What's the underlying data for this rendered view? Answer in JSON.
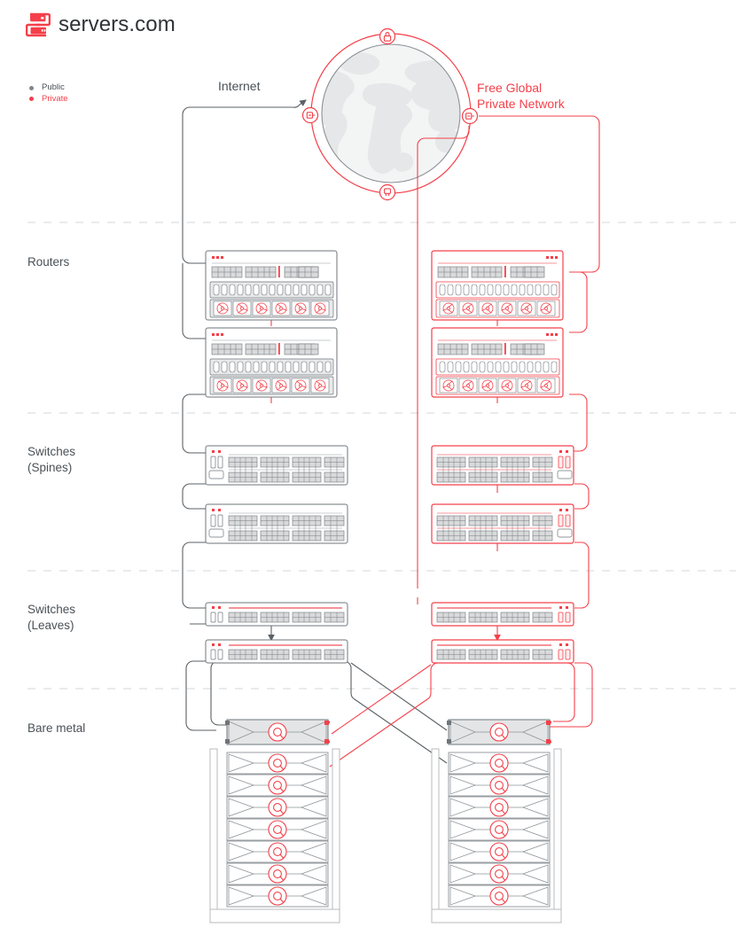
{
  "brand": {
    "name": "servers.com",
    "logo_icon": "servers-logo-icon",
    "color": "#f4404a"
  },
  "legend": {
    "items": [
      {
        "label": "Public",
        "color": "#7e868d",
        "icon": "legend-dot-icon"
      },
      {
        "label": "Private",
        "color": "#f4404a",
        "icon": "legend-dot-icon"
      }
    ]
  },
  "labels": {
    "internet": "Internet",
    "private_network": "Free Global\nPrivate Network",
    "routers": "Routers",
    "spines": "Switches\n(Spines)",
    "leaves": "Switches\n(Leaves)",
    "bare_metal": "Bare metal"
  },
  "globe": {
    "icons": [
      {
        "name": "lock-icon",
        "position": "top"
      },
      {
        "name": "node-left-icon",
        "position": "left"
      },
      {
        "name": "node-right-icon",
        "position": "right"
      },
      {
        "name": "plug-icon",
        "position": "bottom"
      }
    ],
    "map_color": "#e6e7e8",
    "ring_color": "#f4404a",
    "inner_circle_color": "#8a9096"
  },
  "colors": {
    "public_line": "#5b6166",
    "private_line": "#f4404a",
    "device_outline": "#6e757b",
    "device_fill": "#ffffff",
    "port_fill": "#d9dadb",
    "divider": "#d5d7d9",
    "text": "#4a5157"
  },
  "tiers": [
    {
      "id": "routers",
      "label": "Routers",
      "devices": [
        {
          "side": "public",
          "index": 0,
          "type": "router",
          "ports": 16,
          "fans": 6,
          "port_blocks": 4,
          "leds": 3
        },
        {
          "side": "public",
          "index": 1,
          "type": "router",
          "ports": 16,
          "fans": 6,
          "port_blocks": 4,
          "leds": 3
        },
        {
          "side": "private",
          "index": 0,
          "type": "router",
          "ports": 16,
          "fans": 6,
          "port_blocks": 4,
          "leds": 3
        },
        {
          "side": "private",
          "index": 1,
          "type": "router",
          "ports": 16,
          "fans": 6,
          "port_blocks": 4,
          "leds": 3
        }
      ]
    },
    {
      "id": "spines",
      "label": "Switches (Spines)",
      "devices": [
        {
          "side": "public",
          "index": 0,
          "type": "spine-switch",
          "rows": 2,
          "port_blocks_per_row": 4,
          "leds": 2
        },
        {
          "side": "public",
          "index": 1,
          "type": "spine-switch",
          "rows": 2,
          "port_blocks_per_row": 4,
          "leds": 2
        },
        {
          "side": "private",
          "index": 0,
          "type": "spine-switch",
          "rows": 2,
          "port_blocks_per_row": 4,
          "leds": 2
        },
        {
          "side": "private",
          "index": 1,
          "type": "spine-switch",
          "rows": 2,
          "port_blocks_per_row": 4,
          "leds": 2
        }
      ]
    },
    {
      "id": "leaves",
      "label": "Switches (Leaves)",
      "devices": [
        {
          "side": "public",
          "index": 0,
          "type": "leaf-switch",
          "rows": 1,
          "port_blocks_per_row": 4,
          "leds": 2
        },
        {
          "side": "public",
          "index": 1,
          "type": "leaf-switch",
          "rows": 1,
          "port_blocks_per_row": 4,
          "leds": 2
        },
        {
          "side": "private",
          "index": 0,
          "type": "leaf-switch",
          "rows": 1,
          "port_blocks_per_row": 4,
          "leds": 2
        },
        {
          "side": "private",
          "index": 1,
          "type": "leaf-switch",
          "rows": 1,
          "port_blocks_per_row": 4,
          "leds": 2
        }
      ]
    },
    {
      "id": "bare_metal",
      "label": "Bare metal",
      "racks": [
        {
          "side": "left",
          "servers": 8,
          "highlighted_index": 0
        },
        {
          "side": "right",
          "servers": 8,
          "highlighted_index": 0
        }
      ]
    }
  ],
  "dividers": [
    251,
    466,
    644,
    777
  ]
}
